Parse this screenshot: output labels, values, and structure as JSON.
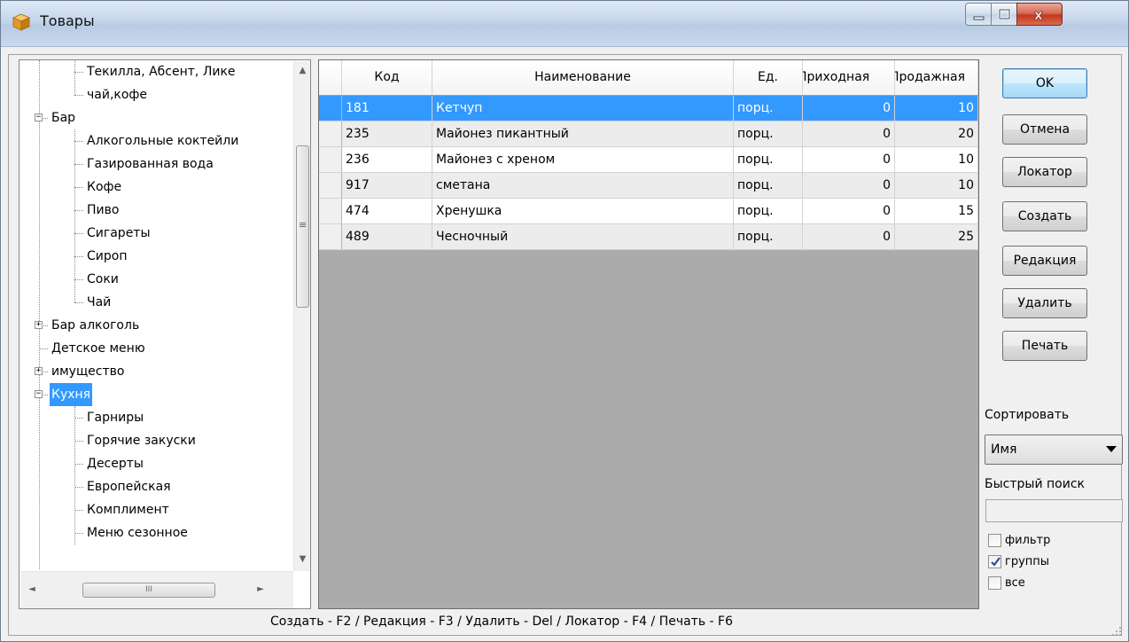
{
  "window": {
    "title": "Товары",
    "close_symbol": "x"
  },
  "tree": {
    "items": [
      {
        "label": "Текилла, Абсент, Лике",
        "level": 2,
        "expander": ""
      },
      {
        "label": "чай,кофе",
        "level": 2,
        "expander": ""
      },
      {
        "label": "Бар",
        "level": 1,
        "expander": "−"
      },
      {
        "label": "Алкогольные коктейли",
        "level": 2,
        "expander": ""
      },
      {
        "label": "Газированная вода",
        "level": 2,
        "expander": ""
      },
      {
        "label": "Кофе",
        "level": 2,
        "expander": ""
      },
      {
        "label": "Пиво",
        "level": 2,
        "expander": ""
      },
      {
        "label": "Сигареты",
        "level": 2,
        "expander": ""
      },
      {
        "label": "Сироп",
        "level": 2,
        "expander": ""
      },
      {
        "label": "Соки",
        "level": 2,
        "expander": ""
      },
      {
        "label": "Чай",
        "level": 2,
        "expander": ""
      },
      {
        "label": "Бар алкоголь",
        "level": 1,
        "expander": "+"
      },
      {
        "label": "Детское меню",
        "level": 1,
        "expander": ""
      },
      {
        "label": "имущество",
        "level": 1,
        "expander": "+"
      },
      {
        "label": "Кухня",
        "level": 1,
        "expander": "−",
        "selected": true
      },
      {
        "label": "Гарниры",
        "level": 2,
        "expander": ""
      },
      {
        "label": "Горячие закуски",
        "level": 2,
        "expander": ""
      },
      {
        "label": "Десерты",
        "level": 2,
        "expander": ""
      },
      {
        "label": "Европейская",
        "level": 2,
        "expander": ""
      },
      {
        "label": "Комплимент",
        "level": 2,
        "expander": ""
      },
      {
        "label": "Меню сезонное",
        "level": 2,
        "expander": ""
      }
    ],
    "vscroll_up": "▲",
    "vscroll_down": "▼",
    "vscroll_grip": "≡",
    "hscroll_left": "◄",
    "hscroll_right": "►",
    "hscroll_grip": "III"
  },
  "grid": {
    "columns": [
      "Код",
      "Наименование",
      "Ед.",
      "Приходная",
      "Продажная"
    ],
    "rows": [
      {
        "code": "181",
        "name": "Кетчуп",
        "unit": "порц.",
        "in_price": "0",
        "sale_price": "10",
        "selected": true
      },
      {
        "code": "235",
        "name": "Майонез пикантный",
        "unit": "порц.",
        "in_price": "0",
        "sale_price": "20"
      },
      {
        "code": "236",
        "name": "Майонез с хреном",
        "unit": "порц.",
        "in_price": "0",
        "sale_price": "10"
      },
      {
        "code": "917",
        "name": "сметана",
        "unit": "порц.",
        "in_price": "0",
        "sale_price": "10"
      },
      {
        "code": "474",
        "name": "Хренушка",
        "unit": "порц.",
        "in_price": "0",
        "sale_price": "15"
      },
      {
        "code": "489",
        "name": "Чесночный",
        "unit": "порц.",
        "in_price": "0",
        "sale_price": "25"
      }
    ]
  },
  "buttons": {
    "ok": "OK",
    "cancel": "Отмена",
    "locator": "Локатор",
    "create": "Создать",
    "edit": "Редакция",
    "delete": "Удалить",
    "print": "Печать"
  },
  "sort": {
    "label": "Сортировать",
    "value": "Имя"
  },
  "quick_search": {
    "label": "Быстрый поиск",
    "value": ""
  },
  "options": {
    "filter": {
      "label": "фильтр",
      "checked": false
    },
    "groups": {
      "label": "группы",
      "checked": true
    },
    "all": {
      "label": "все",
      "checked": false
    }
  },
  "footer": {
    "hint": "Создать - F2 / Редакция - F3 / Удалить - Del / Локатор - F4 / Печать - F6"
  },
  "colors": {
    "selection": "#3399ff",
    "grid_background": "#ababab"
  }
}
